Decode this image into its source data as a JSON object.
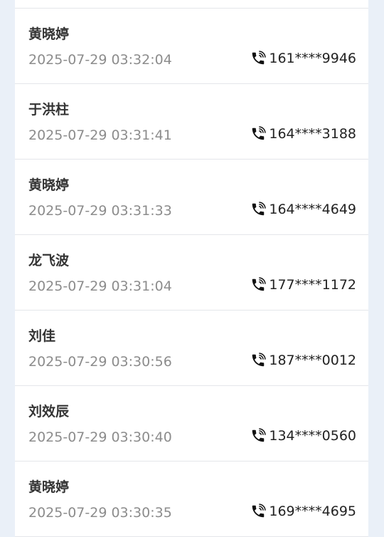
{
  "calls": [
    {
      "name": "",
      "time": "",
      "phone": ""
    },
    {
      "name": "黄晓婷",
      "time": "2025-07-29 03:32:04",
      "phone": "161****9946"
    },
    {
      "name": "于洪柱",
      "time": "2025-07-29 03:31:41",
      "phone": "164****3188"
    },
    {
      "name": "黄晓婷",
      "time": "2025-07-29 03:31:33",
      "phone": "164****4649"
    },
    {
      "name": "龙飞波",
      "time": "2025-07-29 03:31:04",
      "phone": "177****1172"
    },
    {
      "name": "刘佳",
      "time": "2025-07-29 03:30:56",
      "phone": "187****0012"
    },
    {
      "name": "刘效辰",
      "time": "2025-07-29 03:30:40",
      "phone": "134****0560"
    },
    {
      "name": "黄晓婷",
      "time": "2025-07-29 03:30:35",
      "phone": "169****4695"
    }
  ],
  "icons": {
    "phone": "phone-ringing-icon"
  },
  "colors": {
    "background": "#eaf0f8",
    "card": "#ffffff",
    "name": "#333333",
    "time": "#8c8c8c",
    "number": "#222222"
  }
}
